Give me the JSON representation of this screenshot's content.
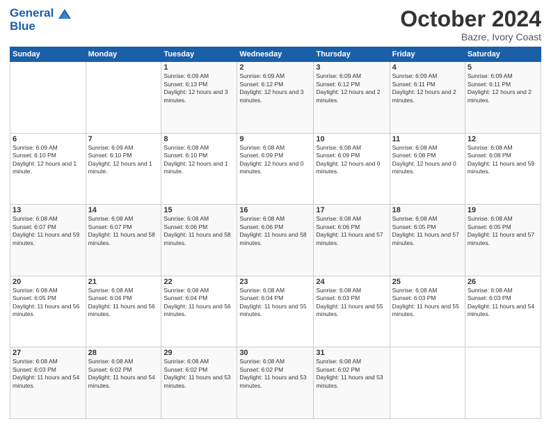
{
  "header": {
    "logo_line1": "General",
    "logo_line2": "Blue",
    "month": "October 2024",
    "location": "Bazre, Ivory Coast"
  },
  "days_of_week": [
    "Sunday",
    "Monday",
    "Tuesday",
    "Wednesday",
    "Thursday",
    "Friday",
    "Saturday"
  ],
  "weeks": [
    [
      {
        "num": "",
        "empty": true
      },
      {
        "num": "",
        "empty": true
      },
      {
        "num": "1",
        "sunrise": "6:09 AM",
        "sunset": "6:13 PM",
        "daylight": "12 hours and 3 minutes."
      },
      {
        "num": "2",
        "sunrise": "6:09 AM",
        "sunset": "6:12 PM",
        "daylight": "12 hours and 3 minutes."
      },
      {
        "num": "3",
        "sunrise": "6:09 AM",
        "sunset": "6:12 PM",
        "daylight": "12 hours and 2 minutes."
      },
      {
        "num": "4",
        "sunrise": "6:09 AM",
        "sunset": "6:11 PM",
        "daylight": "12 hours and 2 minutes."
      },
      {
        "num": "5",
        "sunrise": "6:09 AM",
        "sunset": "6:11 PM",
        "daylight": "12 hours and 2 minutes."
      }
    ],
    [
      {
        "num": "6",
        "sunrise": "6:09 AM",
        "sunset": "6:10 PM",
        "daylight": "12 hours and 1 minute."
      },
      {
        "num": "7",
        "sunrise": "6:09 AM",
        "sunset": "6:10 PM",
        "daylight": "12 hours and 1 minute."
      },
      {
        "num": "8",
        "sunrise": "6:08 AM",
        "sunset": "6:10 PM",
        "daylight": "12 hours and 1 minute."
      },
      {
        "num": "9",
        "sunrise": "6:08 AM",
        "sunset": "6:09 PM",
        "daylight": "12 hours and 0 minutes."
      },
      {
        "num": "10",
        "sunrise": "6:08 AM",
        "sunset": "6:09 PM",
        "daylight": "12 hours and 0 minutes."
      },
      {
        "num": "11",
        "sunrise": "6:08 AM",
        "sunset": "6:08 PM",
        "daylight": "12 hours and 0 minutes."
      },
      {
        "num": "12",
        "sunrise": "6:08 AM",
        "sunset": "6:08 PM",
        "daylight": "11 hours and 59 minutes."
      }
    ],
    [
      {
        "num": "13",
        "sunrise": "6:08 AM",
        "sunset": "6:07 PM",
        "daylight": "11 hours and 59 minutes."
      },
      {
        "num": "14",
        "sunrise": "6:08 AM",
        "sunset": "6:07 PM",
        "daylight": "11 hours and 58 minutes."
      },
      {
        "num": "15",
        "sunrise": "6:08 AM",
        "sunset": "6:06 PM",
        "daylight": "11 hours and 58 minutes."
      },
      {
        "num": "16",
        "sunrise": "6:08 AM",
        "sunset": "6:06 PM",
        "daylight": "11 hours and 58 minutes."
      },
      {
        "num": "17",
        "sunrise": "6:08 AM",
        "sunset": "6:06 PM",
        "daylight": "11 hours and 57 minutes."
      },
      {
        "num": "18",
        "sunrise": "6:08 AM",
        "sunset": "6:05 PM",
        "daylight": "11 hours and 57 minutes."
      },
      {
        "num": "19",
        "sunrise": "6:08 AM",
        "sunset": "6:05 PM",
        "daylight": "11 hours and 57 minutes."
      }
    ],
    [
      {
        "num": "20",
        "sunrise": "6:08 AM",
        "sunset": "6:05 PM",
        "daylight": "11 hours and 56 minutes."
      },
      {
        "num": "21",
        "sunrise": "6:08 AM",
        "sunset": "6:04 PM",
        "daylight": "11 hours and 56 minutes."
      },
      {
        "num": "22",
        "sunrise": "6:08 AM",
        "sunset": "6:04 PM",
        "daylight": "11 hours and 56 minutes."
      },
      {
        "num": "23",
        "sunrise": "6:08 AM",
        "sunset": "6:04 PM",
        "daylight": "11 hours and 55 minutes."
      },
      {
        "num": "24",
        "sunrise": "6:08 AM",
        "sunset": "6:03 PM",
        "daylight": "11 hours and 55 minutes."
      },
      {
        "num": "25",
        "sunrise": "6:08 AM",
        "sunset": "6:03 PM",
        "daylight": "11 hours and 55 minutes."
      },
      {
        "num": "26",
        "sunrise": "6:08 AM",
        "sunset": "6:03 PM",
        "daylight": "11 hours and 54 minutes."
      }
    ],
    [
      {
        "num": "27",
        "sunrise": "6:08 AM",
        "sunset": "6:03 PM",
        "daylight": "11 hours and 54 minutes."
      },
      {
        "num": "28",
        "sunrise": "6:08 AM",
        "sunset": "6:02 PM",
        "daylight": "11 hours and 54 minutes."
      },
      {
        "num": "29",
        "sunrise": "6:08 AM",
        "sunset": "6:02 PM",
        "daylight": "11 hours and 53 minutes."
      },
      {
        "num": "30",
        "sunrise": "6:08 AM",
        "sunset": "6:02 PM",
        "daylight": "11 hours and 53 minutes."
      },
      {
        "num": "31",
        "sunrise": "6:08 AM",
        "sunset": "6:02 PM",
        "daylight": "11 hours and 53 minutes."
      },
      {
        "num": "",
        "empty": true
      },
      {
        "num": "",
        "empty": true
      }
    ]
  ],
  "labels": {
    "sunrise": "Sunrise:",
    "sunset": "Sunset:",
    "daylight": "Daylight:"
  }
}
